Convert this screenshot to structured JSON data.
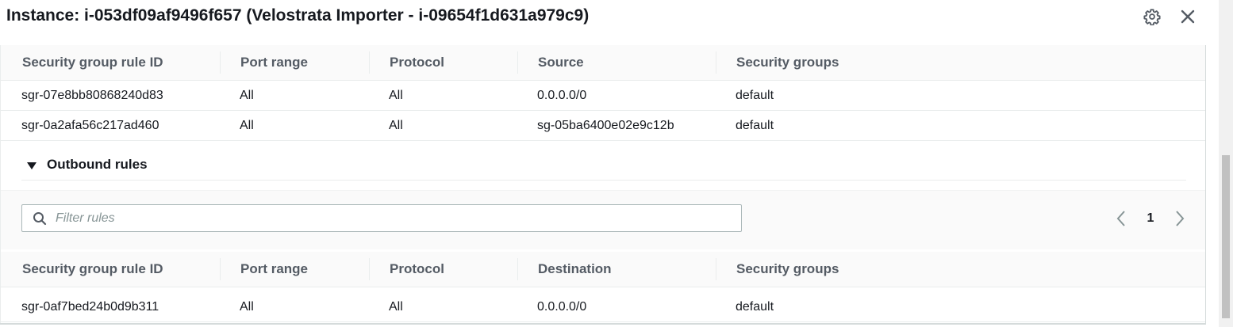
{
  "header": {
    "title": "Instance: i-053df09af9496f657 (Velostrata Importer - i-09654f1d631a979c9)",
    "settings_icon": "gear-icon",
    "close_icon": "close-icon"
  },
  "inbound_table": {
    "columns": [
      "Security group rule ID",
      "Port range",
      "Protocol",
      "Source",
      "Security groups"
    ],
    "rows": [
      [
        "sgr-07e8bb80868240d83",
        "All",
        "All",
        "0.0.0.0/0",
        "default"
      ],
      [
        "sgr-0a2afa56c217ad460",
        "All",
        "All",
        "sg-05ba6400e02e9c12b",
        "default"
      ]
    ]
  },
  "outbound": {
    "section_title": "Outbound rules",
    "filter": {
      "placeholder": "Filter rules",
      "value": ""
    },
    "pagination": {
      "current_page": "1"
    },
    "columns": [
      "Security group rule ID",
      "Port range",
      "Protocol",
      "Destination",
      "Security groups"
    ],
    "rows": [
      [
        "sgr-0af7bed24b0d9b311",
        "All",
        "All",
        "0.0.0.0/0",
        "default"
      ]
    ]
  },
  "colors": {
    "text": "#16191f",
    "header_text": "#545b64",
    "border": "#eaeded",
    "placeholder": "#879596"
  }
}
